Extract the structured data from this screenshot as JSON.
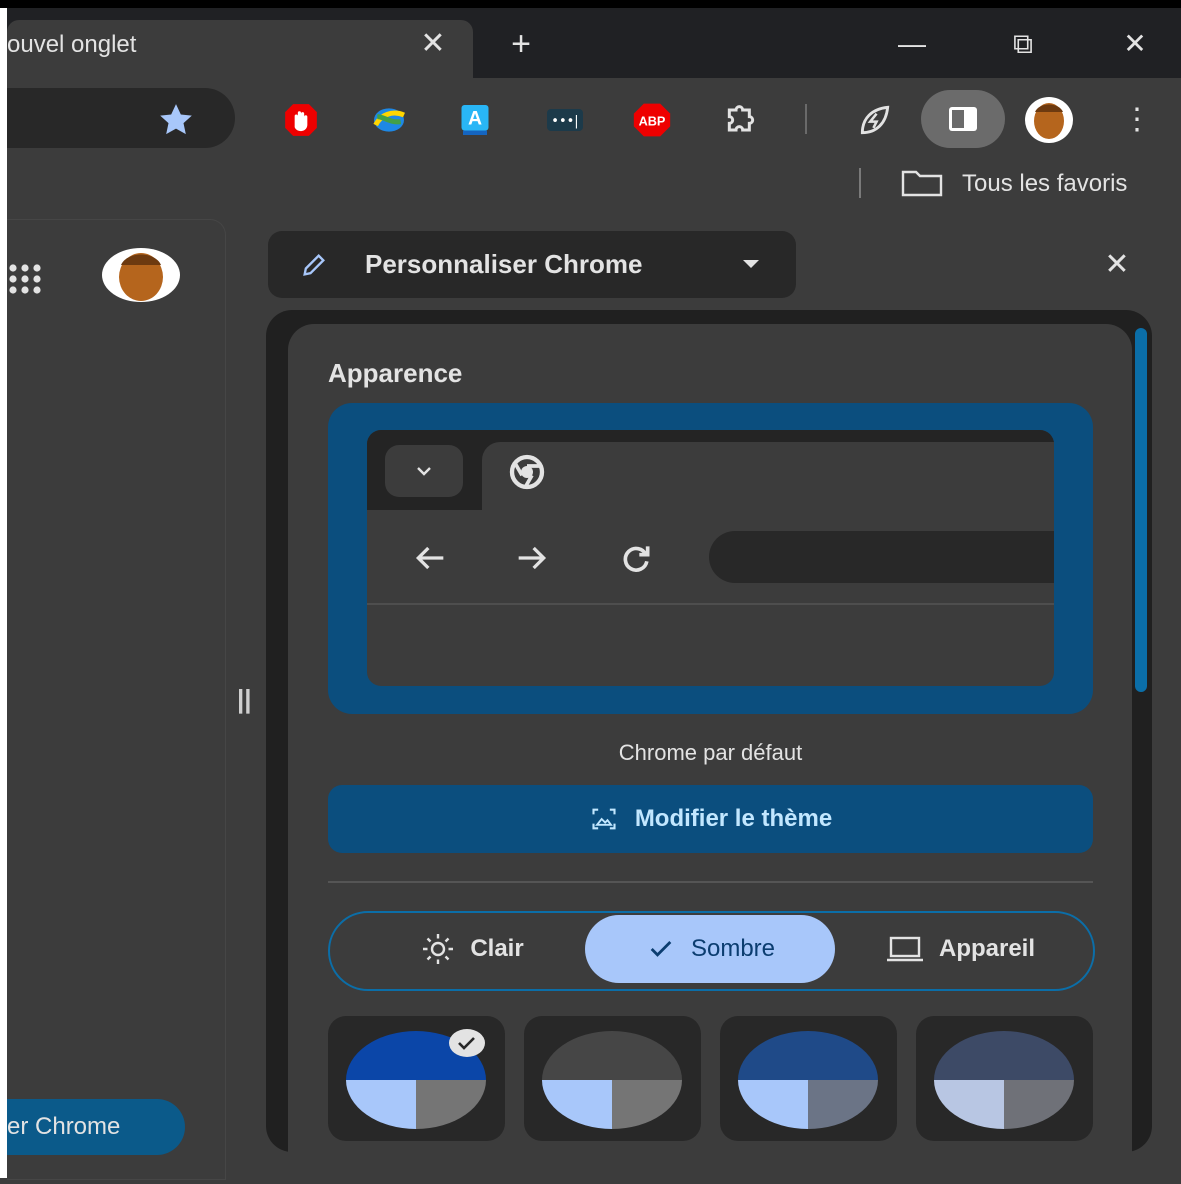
{
  "tab": {
    "title": "ouvel onglet"
  },
  "window": {
    "minimize": "—",
    "restore": "⧉",
    "close": "✕",
    "new_tab": "+",
    "tab_close": "✕"
  },
  "toolbar": {
    "extensions": [
      "adblock-hand-icon",
      "idm-icon",
      "translate-icon",
      "password-dots-icon",
      "abp-icon",
      "extensions-puzzle-icon",
      "energy-saver-icon",
      "side-panel-icon",
      "profile-avatar",
      "menu-kebab-icon"
    ],
    "abp_label": "ABP",
    "dots_label": "•••|",
    "menu": "⋮"
  },
  "bookmarks": {
    "folder_label": "Tous les favoris"
  },
  "page": {
    "customize_button": "er Chrome"
  },
  "panel": {
    "title": "Personnaliser Chrome",
    "close": "✕",
    "appearance_title": "Apparence",
    "theme_name": "Chrome par défaut",
    "change_theme": "Modifier le thème",
    "modes": {
      "light": "Clair",
      "dark": "Sombre",
      "device": "Appareil"
    },
    "swatches": [
      {
        "name": "default-blue",
        "top": "#0b46a8",
        "bl": "#a8c7fa",
        "br": "#757575",
        "selected": true
      },
      {
        "name": "grey",
        "top": "#464646",
        "bl": "#a8c7fa",
        "br": "#757575",
        "selected": false
      },
      {
        "name": "navy",
        "top": "#1f4a88",
        "bl": "#a8c7fa",
        "br": "#6b7486",
        "selected": false
      },
      {
        "name": "slate",
        "top": "#3d4a66",
        "bl": "#b8c6e3",
        "br": "#6f7178",
        "selected": false
      }
    ]
  },
  "colors": {
    "accent": "#0b4e7e",
    "selected_mode": "#a8c7fa",
    "scrollbar": "#0b6ea8"
  }
}
